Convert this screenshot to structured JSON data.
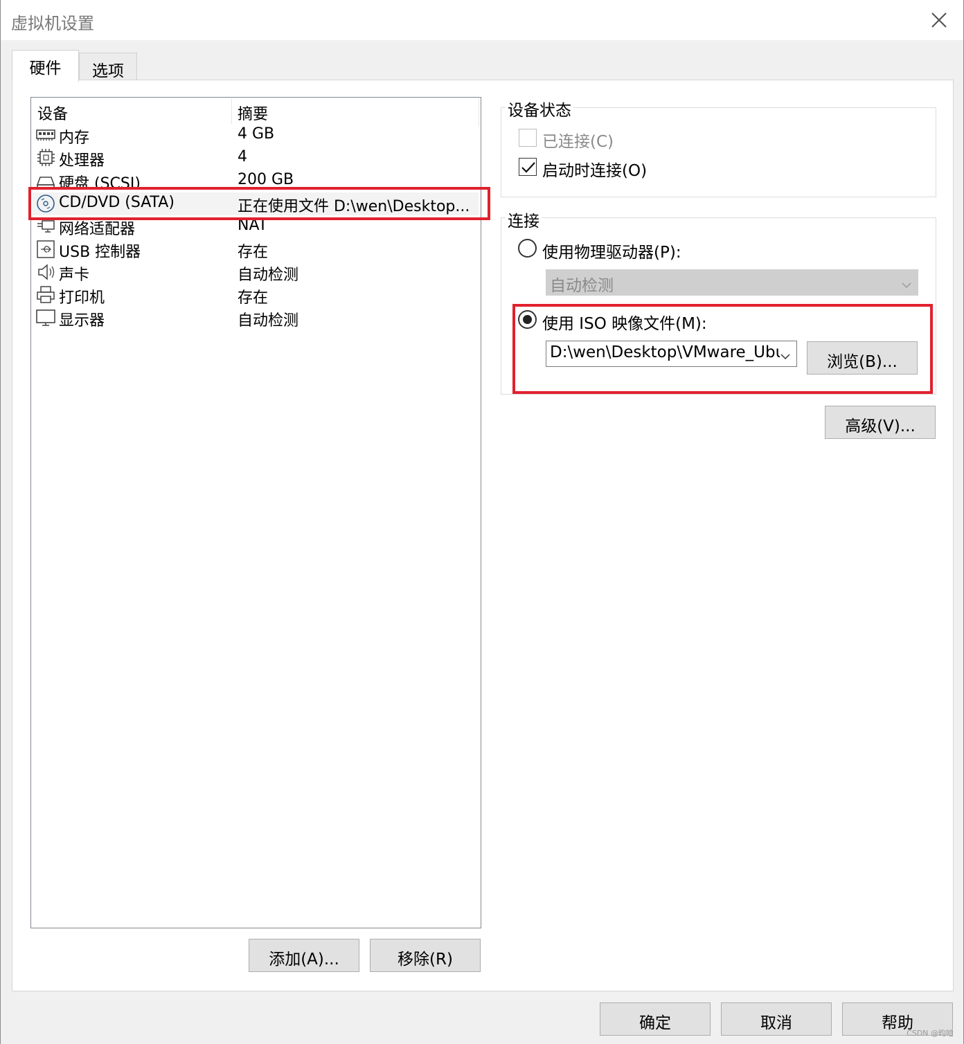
{
  "window": {
    "title": "虚拟机设置"
  },
  "tabs": [
    {
      "label": "硬件"
    },
    {
      "label": "选项"
    }
  ],
  "device_list": {
    "columns": {
      "device": "设备",
      "summary": "摘要"
    },
    "rows": [
      {
        "icon": "memory-icon",
        "name": "内存",
        "summary": "4 GB"
      },
      {
        "icon": "processor-icon",
        "name": "处理器",
        "summary": "4"
      },
      {
        "icon": "hard-disk-icon",
        "name": "硬盘 (SCSI)",
        "summary": "200 GB"
      },
      {
        "icon": "cd-dvd-icon",
        "name": "CD/DVD (SATA)",
        "summary": "正在使用文件 D:\\wen\\Desktop..."
      },
      {
        "icon": "network-adapter-icon",
        "name": "网络适配器",
        "summary": "NAT"
      },
      {
        "icon": "usb-icon",
        "name": "USB 控制器",
        "summary": "存在"
      },
      {
        "icon": "sound-card-icon",
        "name": "声卡",
        "summary": "自动检测"
      },
      {
        "icon": "printer-icon",
        "name": "打印机",
        "summary": "存在"
      },
      {
        "icon": "display-icon",
        "name": "显示器",
        "summary": "自动检测"
      }
    ],
    "selected_index": 3
  },
  "device_status": {
    "label": "设备状态",
    "connected": {
      "label": "已连接(C)",
      "checked": false,
      "enabled": false
    },
    "connect_at_power_on": {
      "label": "启动时连接(O)",
      "checked": true,
      "enabled": true
    }
  },
  "connection": {
    "label": "连接",
    "physical_drive": {
      "label": "使用物理驱动器(P):",
      "selected": false,
      "value": "自动检测"
    },
    "iso_image": {
      "label": "使用 ISO 映像文件(M):",
      "selected": true,
      "value": "D:\\wen\\Desktop\\VMware_Ubu",
      "browse_label": "浏览(B)..."
    },
    "advanced_label": "高级(V)..."
  },
  "list_buttons": {
    "add": "添加(A)...",
    "remove": "移除(R)"
  },
  "dialog_buttons": {
    "ok": "确定",
    "cancel": "取消",
    "help": "帮助"
  },
  "watermark": "CSDN @昀哈",
  "colors": {
    "highlight_box": "#e0212e",
    "button_bg": "#e1e1e1",
    "disabled_combo": "#cfcfcf"
  }
}
